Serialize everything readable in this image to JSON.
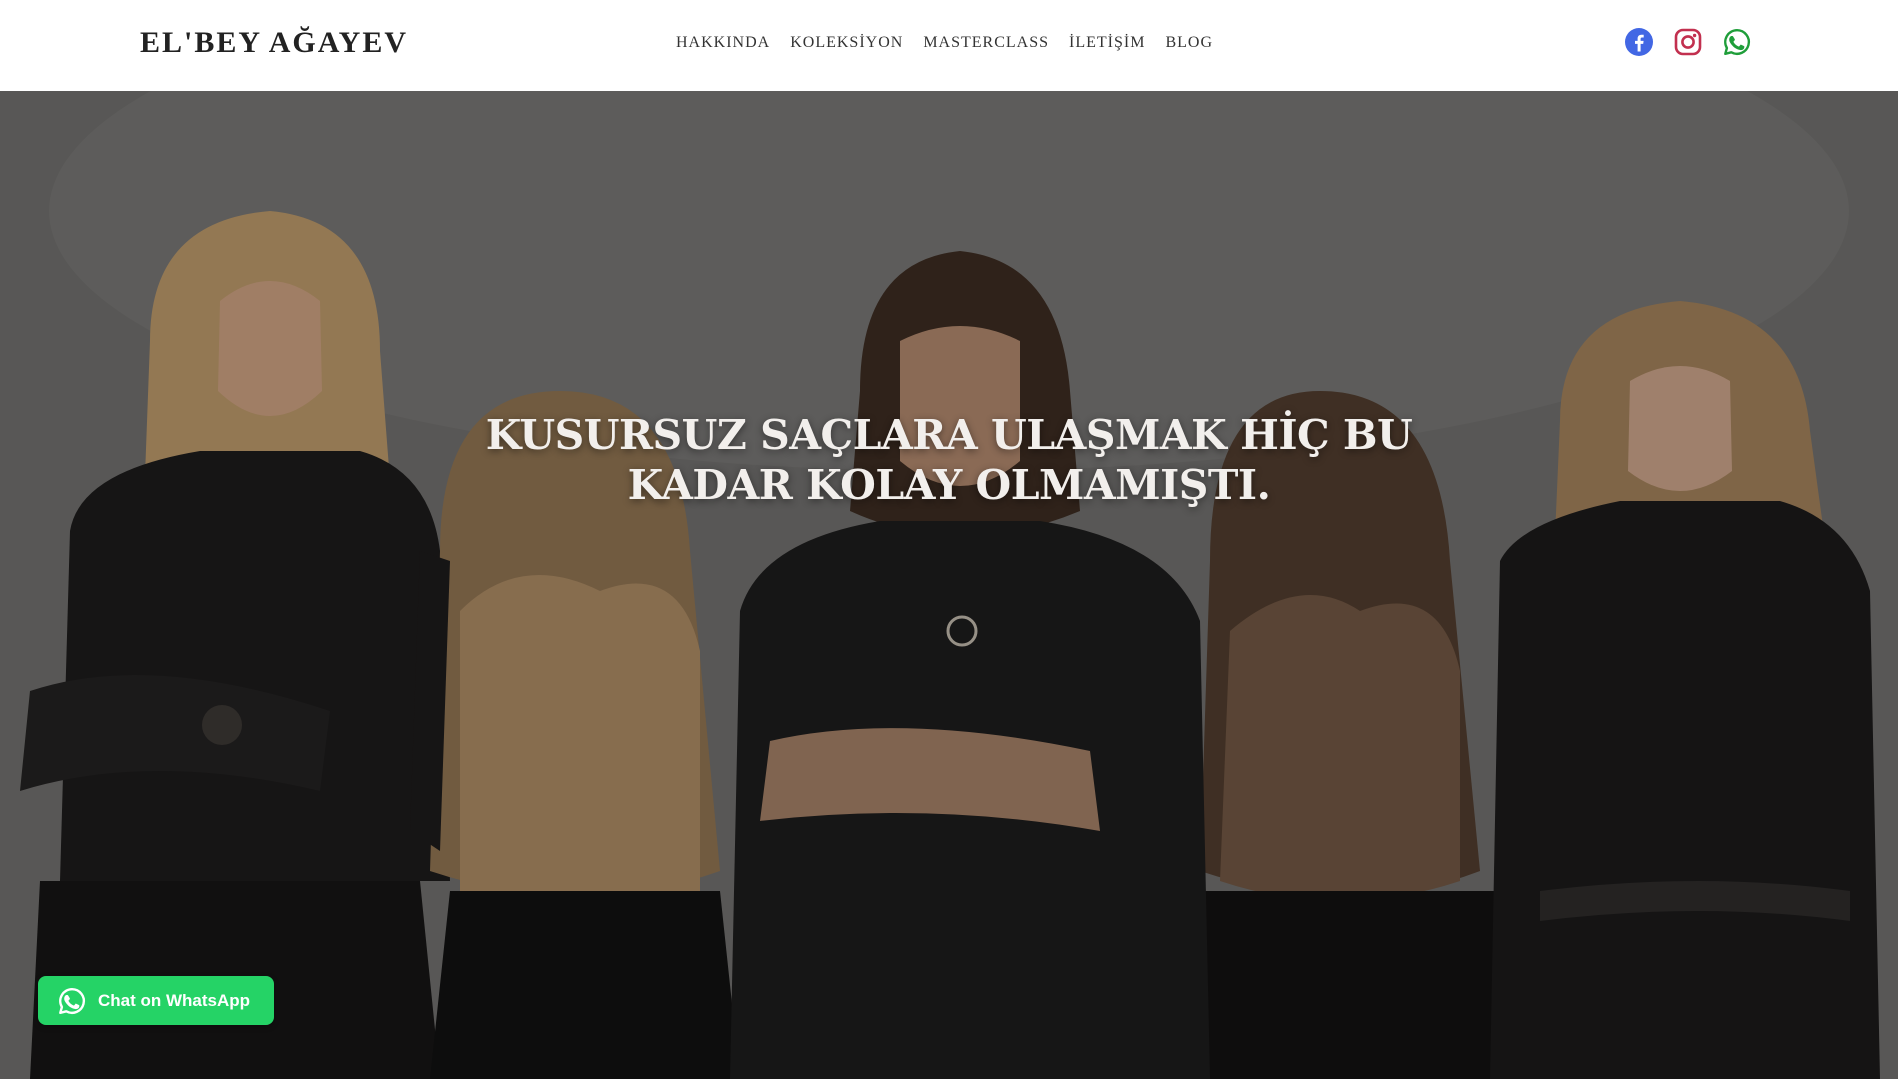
{
  "header": {
    "logo": "EL'BEY AĞAYEV",
    "nav": [
      "HAKKINDA",
      "KOLEKSİYON",
      "MASTERCLASS",
      "İLETİŞİM",
      "BLOG"
    ],
    "socials": [
      {
        "icon": "facebook-icon",
        "color": "#4267e4"
      },
      {
        "icon": "instagram-icon",
        "color": "#c2304f"
      },
      {
        "icon": "whatsapp-icon",
        "color": "#1f9e3a"
      }
    ]
  },
  "hero": {
    "title": "KUSURSUZ SAÇLARA ULAŞMAK HİÇ BU KADAR KOLAY OLMAMIŞTI.",
    "image": "group-photo-of-five-people-in-black-outfits"
  },
  "whatsapp_chat": {
    "label": "Chat on WhatsApp",
    "color": "#25d366"
  }
}
